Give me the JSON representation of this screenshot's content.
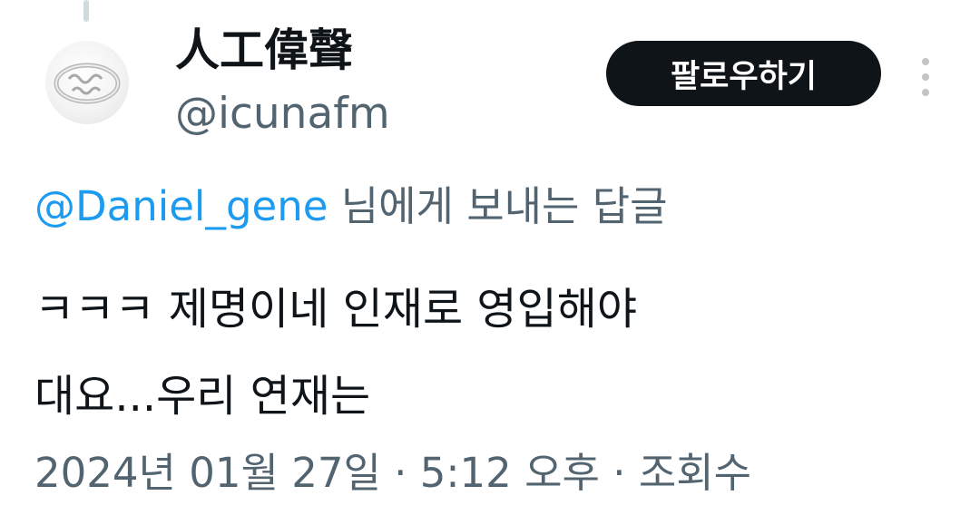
{
  "user": {
    "display_name": "人工偉聲",
    "handle": "@icunafm",
    "avatar_icon": "ring-icon"
  },
  "follow_button": {
    "label": "팔로우하기"
  },
  "more_button": {
    "icon": "more-vertical-icon"
  },
  "reply": {
    "mention": "@Daniel_gene",
    "suffix": " 님에게 보내는 답글"
  },
  "tweet": {
    "line1": "ㅋㅋㅋ 제명이네 인재로 영입해야",
    "line2": "대요...우리 연재는"
  },
  "meta": {
    "datetime": "2024년 01월 27일 · 5:12 오후 · 조회수"
  },
  "colors": {
    "text": "#0f1419",
    "secondary": "#536471",
    "link": "#1d9bf0",
    "button_bg": "#0f1419"
  }
}
